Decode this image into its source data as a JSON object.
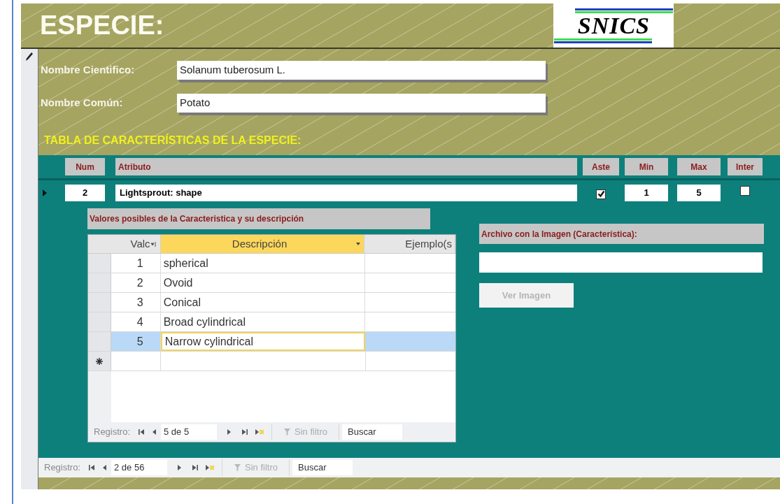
{
  "header": {
    "title": "ESPECIE:",
    "logo": "SNICS"
  },
  "form": {
    "fields": [
      {
        "label": "Nombre Cientifico:",
        "value": "Solanum tuberosum L."
      },
      {
        "label": "Nombre Común:",
        "value": "Potato"
      }
    ],
    "section_title": "TABLA DE CARACTERÍSTICAS DE LA ESPECIE:"
  },
  "characteristics": {
    "columns": [
      "Num",
      "Atributo",
      "Aste",
      "Min",
      "Max",
      "Inter"
    ],
    "row": {
      "current": true,
      "num": "2",
      "attribute": "Lightsprout: shape",
      "aste": {
        "checked": true
      },
      "min": "1",
      "max": "5",
      "inter": {
        "checked": false
      }
    }
  },
  "values_subform": {
    "title": "Valores posibles de la Caracteristica y su descripción",
    "columns": [
      {
        "label": "Valc",
        "selected": false,
        "kind": "sorted"
      },
      {
        "label": "Descripción",
        "selected": true,
        "kind": "dropdown"
      },
      {
        "label": "Ejemplo(s",
        "selected": false,
        "kind": "plain"
      }
    ],
    "rows": [
      {
        "value": "1",
        "description": "spherical",
        "selected": false
      },
      {
        "value": "2",
        "description": "Ovoid",
        "selected": false
      },
      {
        "value": "3",
        "description": "Conical",
        "selected": false
      },
      {
        "value": "4",
        "description": "Broad cylindrical",
        "selected": false
      },
      {
        "value": "5",
        "description": "Narrow cylindrical",
        "selected": true
      }
    ],
    "navigator": {
      "label": "Registro:",
      "position": "5 de 5",
      "filter": "Sin filtro",
      "search": "Buscar"
    }
  },
  "image_panel": {
    "label": "Archivo con la Imagen (Característica):",
    "button": {
      "label": "Ver Imagen",
      "disabled": true
    }
  },
  "navigator": {
    "label": "Registro:",
    "position": "2 de 56",
    "filter": "Sin filtro",
    "search": "Buscar"
  }
}
